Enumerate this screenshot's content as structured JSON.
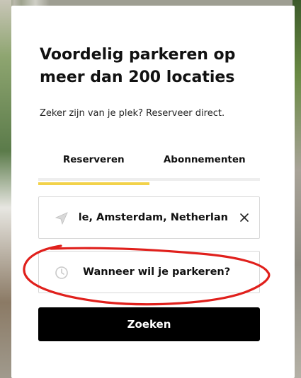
{
  "card": {
    "title": "Voordelig parkeren op meer dan 200 locaties",
    "subtitle": "Zeker zijn van je plek? Reserveer direct."
  },
  "tabs": [
    {
      "label": "Reserveren",
      "active": true
    },
    {
      "label": "Abonnementen",
      "active": false
    }
  ],
  "location_field": {
    "value": "le, Amsterdam, Netherlan",
    "icon": "navigation-arrow-icon",
    "clear_icon": "close-icon"
  },
  "when_field": {
    "label": "Wanneer wil je parkeren?",
    "icon": "clock-icon"
  },
  "search_button": {
    "label": "Zoeken"
  },
  "colors": {
    "accent": "#f2d24a",
    "button_bg": "#000000",
    "annotation": "#e0201c"
  }
}
